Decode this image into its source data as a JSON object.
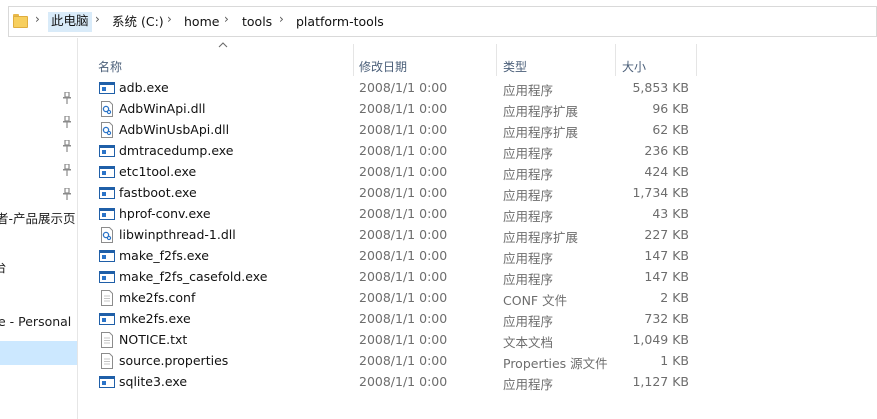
{
  "addressbar": {
    "folder_icon": "folder-icon",
    "separator": "›",
    "breadcrumbs": [
      "此电脑",
      "系统 (C:)",
      "home",
      "tools",
      "platform-tools"
    ]
  },
  "navpane": {
    "items": [
      "者-产品展示页",
      "台",
      "e - Personal"
    ]
  },
  "columns": {
    "name": "名称",
    "date": "修改日期",
    "type": "类型",
    "size": "大小"
  },
  "files": [
    {
      "name": "adb.exe",
      "date": "2008/1/1 0:00",
      "type": "应用程序",
      "size": "5,853 KB",
      "icon": "exe"
    },
    {
      "name": "AdbWinApi.dll",
      "date": "2008/1/1 0:00",
      "type": "应用程序扩展",
      "size": "96 KB",
      "icon": "dll"
    },
    {
      "name": "AdbWinUsbApi.dll",
      "date": "2008/1/1 0:00",
      "type": "应用程序扩展",
      "size": "62 KB",
      "icon": "dll"
    },
    {
      "name": "dmtracedump.exe",
      "date": "2008/1/1 0:00",
      "type": "应用程序",
      "size": "236 KB",
      "icon": "exe"
    },
    {
      "name": "etc1tool.exe",
      "date": "2008/1/1 0:00",
      "type": "应用程序",
      "size": "424 KB",
      "icon": "exe"
    },
    {
      "name": "fastboot.exe",
      "date": "2008/1/1 0:00",
      "type": "应用程序",
      "size": "1,734 KB",
      "icon": "exe"
    },
    {
      "name": "hprof-conv.exe",
      "date": "2008/1/1 0:00",
      "type": "应用程序",
      "size": "43 KB",
      "icon": "exe"
    },
    {
      "name": "libwinpthread-1.dll",
      "date": "2008/1/1 0:00",
      "type": "应用程序扩展",
      "size": "227 KB",
      "icon": "dll"
    },
    {
      "name": "make_f2fs.exe",
      "date": "2008/1/1 0:00",
      "type": "应用程序",
      "size": "147 KB",
      "icon": "exe"
    },
    {
      "name": "make_f2fs_casefold.exe",
      "date": "2008/1/1 0:00",
      "type": "应用程序",
      "size": "147 KB",
      "icon": "exe"
    },
    {
      "name": "mke2fs.conf",
      "date": "2008/1/1 0:00",
      "type": "CONF 文件",
      "size": "2 KB",
      "icon": "file"
    },
    {
      "name": "mke2fs.exe",
      "date": "2008/1/1 0:00",
      "type": "应用程序",
      "size": "732 KB",
      "icon": "exe"
    },
    {
      "name": "NOTICE.txt",
      "date": "2008/1/1 0:00",
      "type": "文本文档",
      "size": "1,049 KB",
      "icon": "file"
    },
    {
      "name": "source.properties",
      "date": "2008/1/1 0:00",
      "type": "Properties 源文件",
      "size": "1 KB",
      "icon": "file"
    },
    {
      "name": "sqlite3.exe",
      "date": "2008/1/1 0:00",
      "type": "应用程序",
      "size": "1,127 KB",
      "icon": "exe"
    }
  ],
  "colors": {
    "selection": "#cce8ff",
    "breadcrumb_active": "#d9ebf9",
    "header_text": "#4c607a",
    "exe_icon_blue": "#1f5fa8"
  }
}
